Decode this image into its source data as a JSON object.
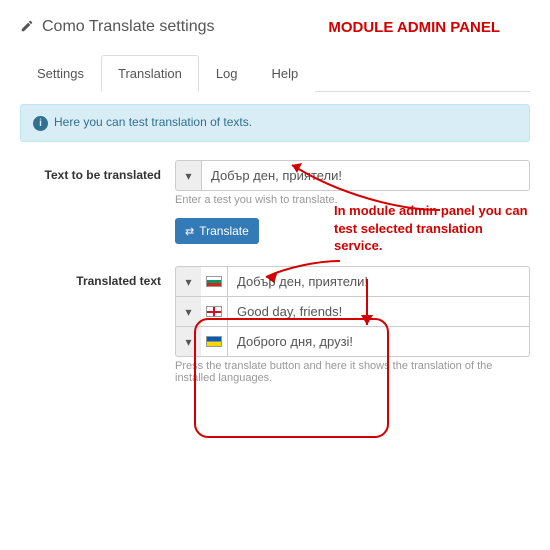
{
  "header": {
    "title": "Como Translate settings",
    "banner": "MODULE ADMIN PANEL"
  },
  "tabs": {
    "items": [
      "Settings",
      "Translation",
      "Log",
      "Help"
    ],
    "activeIndex": 1
  },
  "info": {
    "text": "Here you can test translation of texts."
  },
  "form": {
    "input_label": "Text to be translated",
    "input_value": "Добър ден, приятели!",
    "input_help": "Enter a test you wish to translate.",
    "button_label": "Translate",
    "output_label": "Translated text",
    "output_help": "Press the translate button and here it shows the translation of the installed languages.",
    "results": [
      {
        "flag": "bul",
        "text": "Добър ден, приятели!"
      },
      {
        "flag": "eng",
        "text": "Good day, friends!"
      },
      {
        "flag": "ukr",
        "text": "Доброго дня, друзі!"
      }
    ]
  },
  "callout": {
    "text": "In module admin panel you can test selected translation service."
  },
  "icons": {
    "toggle": "▾",
    "info": "i",
    "translate": "⇄"
  }
}
